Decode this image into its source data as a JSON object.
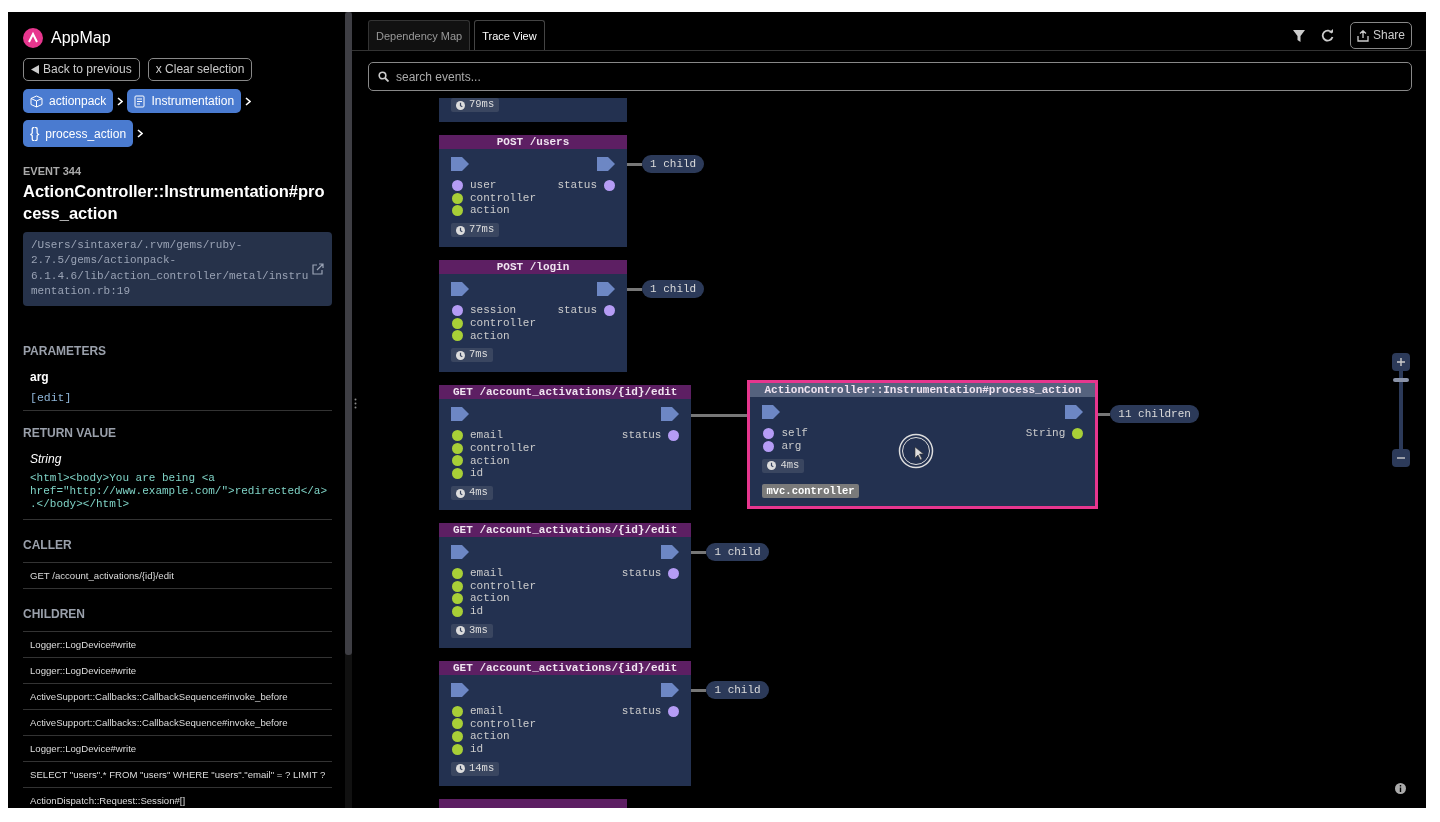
{
  "sidebar": {
    "app_name": "AppMap",
    "buttons": [
      {
        "kind": "back",
        "label": "Back to previous"
      },
      {
        "kind": "clear",
        "label": "x Clear selection"
      }
    ],
    "breadcrumbs": [
      {
        "kind": "package",
        "label": "actionpack"
      },
      {
        "kind": "class",
        "label": "Instrumentation"
      },
      {
        "kind": "function",
        "glyph": "{}",
        "label": "process_action"
      }
    ],
    "event_label": "EVENT 344",
    "event_title": "ActionController::Instrumentation#process_action",
    "source_path": "/Users/sintaxera/.rvm/gems/ruby-2.7.5/gems/actionpack-6.1.4.6/lib/action_controller/metal/instrumentation.rb:19",
    "parameters": {
      "heading": "PARAMETERS",
      "items": [
        {
          "name": "arg",
          "value": "[edit]"
        }
      ]
    },
    "return_value": {
      "heading": "RETURN VALUE",
      "type": "String",
      "value": "<html><body>You are being <a href=\"http://www.example.com/\">redirected</a>.</body></html>"
    },
    "caller": {
      "heading": "CALLER",
      "items": [
        "GET /account_activations/{id}/edit"
      ]
    },
    "children": {
      "heading": "CHILDREN",
      "items": [
        "Logger::LogDevice#write",
        "Logger::LogDevice#write",
        "ActiveSupport::Callbacks::CallbackSequence#invoke_before",
        "ActiveSupport::Callbacks::CallbackSequence#invoke_before",
        "Logger::LogDevice#write",
        "SELECT \"users\".* FROM \"users\" WHERE \"users\".\"email\" = ? LIMIT ?",
        "ActionDispatch::Request::Session#[]"
      ]
    }
  },
  "tabs": [
    {
      "label": "Dependency Map",
      "selected": false
    },
    {
      "label": "Trace View",
      "selected": true
    }
  ],
  "toolbar": {
    "share_label": "Share"
  },
  "search": {
    "placeholder": "search events..."
  },
  "trace": {
    "nodes": [
      {
        "kind": "http",
        "selected": false,
        "elapsed": "79ms"
      },
      {
        "kind": "http",
        "selected": false,
        "title": "POST /users",
        "inputs": [
          {
            "name": "user",
            "color": "#b59cf5"
          },
          {
            "name": "controller",
            "color": "#a8cf37"
          },
          {
            "name": "action",
            "color": "#a8cf37"
          }
        ],
        "outputs": [
          {
            "name": "status",
            "color": "#b59cf5"
          }
        ],
        "elapsed": "77ms",
        "children_label": "1 child"
      },
      {
        "kind": "http",
        "selected": false,
        "title": "POST /login",
        "inputs": [
          {
            "name": "session",
            "color": "#b59cf5"
          },
          {
            "name": "controller",
            "color": "#a8cf37"
          },
          {
            "name": "action",
            "color": "#a8cf37"
          }
        ],
        "outputs": [
          {
            "name": "status",
            "color": "#b59cf5"
          }
        ],
        "elapsed": "7ms",
        "children_label": "1 child"
      },
      {
        "kind": "http",
        "selected": false,
        "title": "GET /account_activations/{id}/edit",
        "inputs": [
          {
            "name": "email",
            "color": "#a8cf37"
          },
          {
            "name": "controller",
            "color": "#a8cf37"
          },
          {
            "name": "action",
            "color": "#a8cf37"
          },
          {
            "name": "id",
            "color": "#a8cf37"
          }
        ],
        "outputs": [
          {
            "name": "status",
            "color": "#b59cf5"
          }
        ],
        "elapsed": "4ms",
        "children": [
          {
            "kind": "function",
            "selected": true,
            "title": "ActionController::Instrumentation#process_action",
            "inputs": [
              {
                "name": "self",
                "color": "#b59cf5"
              },
              {
                "name": "arg",
                "color": "#b59cf5"
              }
            ],
            "outputs": [
              {
                "name": "String",
                "color": "#a8cf37"
              }
            ],
            "elapsed": "4ms",
            "labels": [
              "mvc.controller"
            ],
            "children_label": "11 children"
          }
        ]
      },
      {
        "kind": "http",
        "selected": false,
        "title": "GET /account_activations/{id}/edit",
        "inputs": [
          {
            "name": "email",
            "color": "#a8cf37"
          },
          {
            "name": "controller",
            "color": "#a8cf37"
          },
          {
            "name": "action",
            "color": "#a8cf37"
          },
          {
            "name": "id",
            "color": "#a8cf37"
          }
        ],
        "outputs": [
          {
            "name": "status",
            "color": "#b59cf5"
          }
        ],
        "elapsed": "3ms",
        "children_label": "1 child"
      },
      {
        "kind": "http",
        "selected": false,
        "title": "GET /account_activations/{id}/edit",
        "inputs": [
          {
            "name": "email",
            "color": "#a8cf37"
          },
          {
            "name": "controller",
            "color": "#a8cf37"
          },
          {
            "name": "action",
            "color": "#a8cf37"
          },
          {
            "name": "id",
            "color": "#a8cf37"
          }
        ],
        "outputs": [
          {
            "name": "status",
            "color": "#b59cf5"
          }
        ],
        "elapsed": "14ms",
        "children_label": "1 child"
      },
      {
        "kind": "http",
        "selected": false
      }
    ],
    "zoom": {
      "level": 0.9
    }
  }
}
